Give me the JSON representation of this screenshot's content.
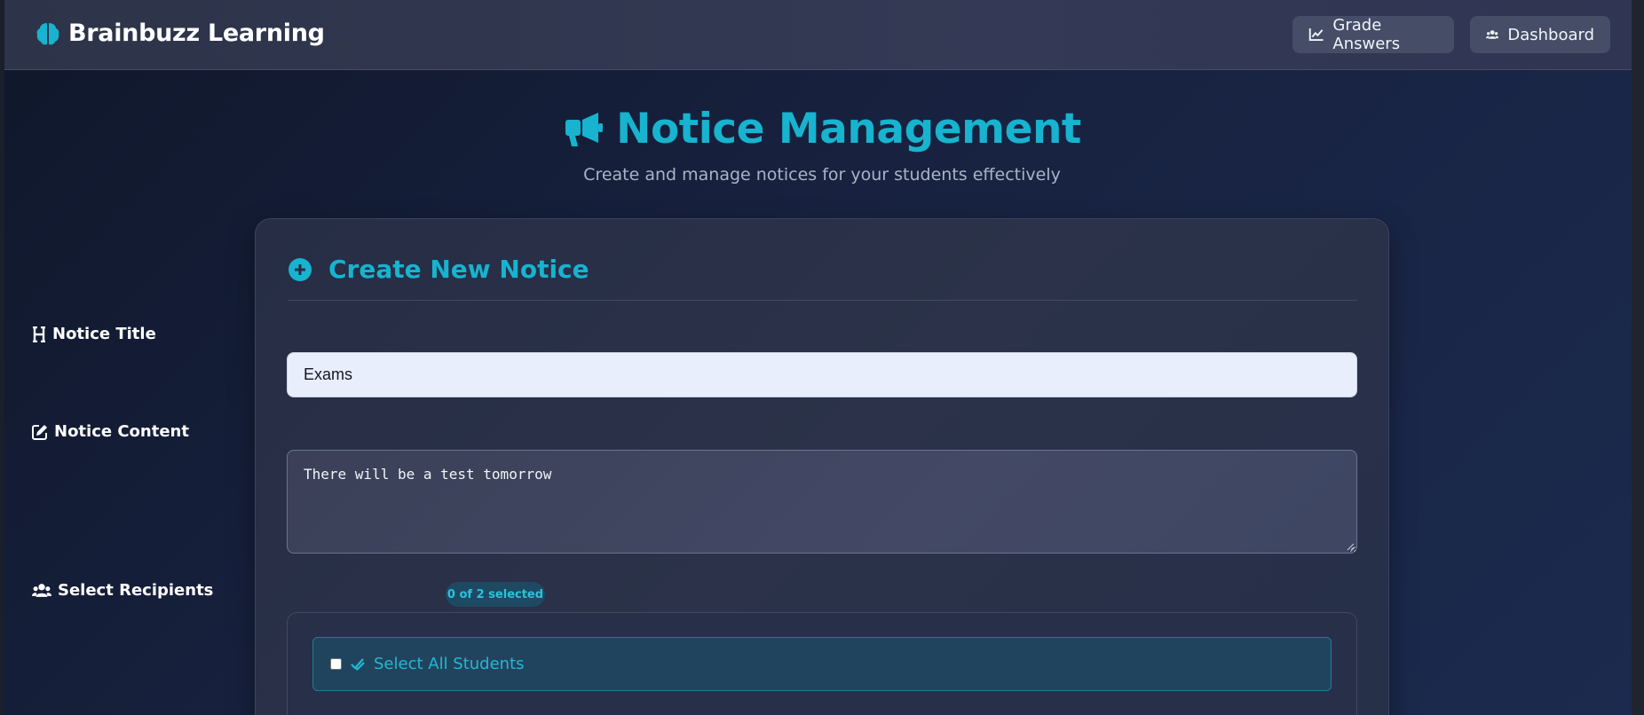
{
  "navbar": {
    "brand": "Brainbuzz Learning",
    "brand_icon": "brain-icon",
    "buttons": [
      {
        "label": "Grade Answers",
        "icon": "chart-line-icon"
      },
      {
        "label": "Dashboard",
        "icon": "users-icon"
      }
    ]
  },
  "page": {
    "title": "Notice Management",
    "title_icon": "megaphone-icon",
    "subtitle": "Create and manage notices for your students effectively"
  },
  "form": {
    "header": "Create New Notice",
    "header_icon": "plus-circle-icon",
    "title_label": "Notice Title",
    "title_value": "Exams",
    "content_label": "Notice Content",
    "content_value": "There will be a test tomorrow",
    "recipients_label": "Select Recipients",
    "recipients_badge": "0 of 2 selected",
    "select_all_label": "Select All Students"
  },
  "colors": {
    "accent": "#17b3cf",
    "background": "#182240",
    "card": "#2b3249",
    "navbar": "#343a55",
    "input_bg": "#e8eefb"
  }
}
